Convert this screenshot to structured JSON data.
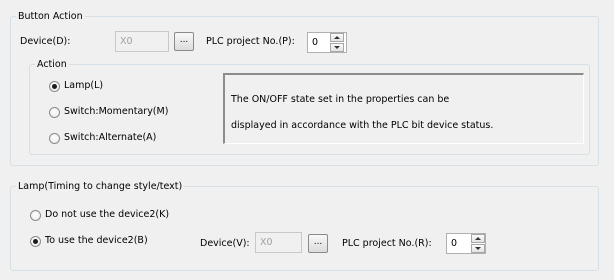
{
  "button_action": {
    "title": "Button Action",
    "device_label": "Device(D):",
    "device_value": "X0",
    "browse_label": "...",
    "plc_label": "PLC project No.(P):",
    "plc_value": "0",
    "action": {
      "title": "Action",
      "options": [
        "Lamp(L)",
        "Switch:Momentary(M)",
        "Switch:Alternate(A)"
      ],
      "selected": "Lamp(L)"
    },
    "description": [
      "The ON/OFF state set in the properties can be",
      "displayed in accordance with the PLC bit device status."
    ]
  },
  "lamp_timing": {
    "title": "Lamp(Timing to change style/text)",
    "options": [
      "Do not use the device2(K)",
      "To use the device2(B)"
    ],
    "selected": "To use the device2(B)",
    "device_label": "Device(V):",
    "device_value": "X0",
    "browse_label": "...",
    "plc_label": "PLC project No.(R):",
    "plc_value": "0"
  }
}
